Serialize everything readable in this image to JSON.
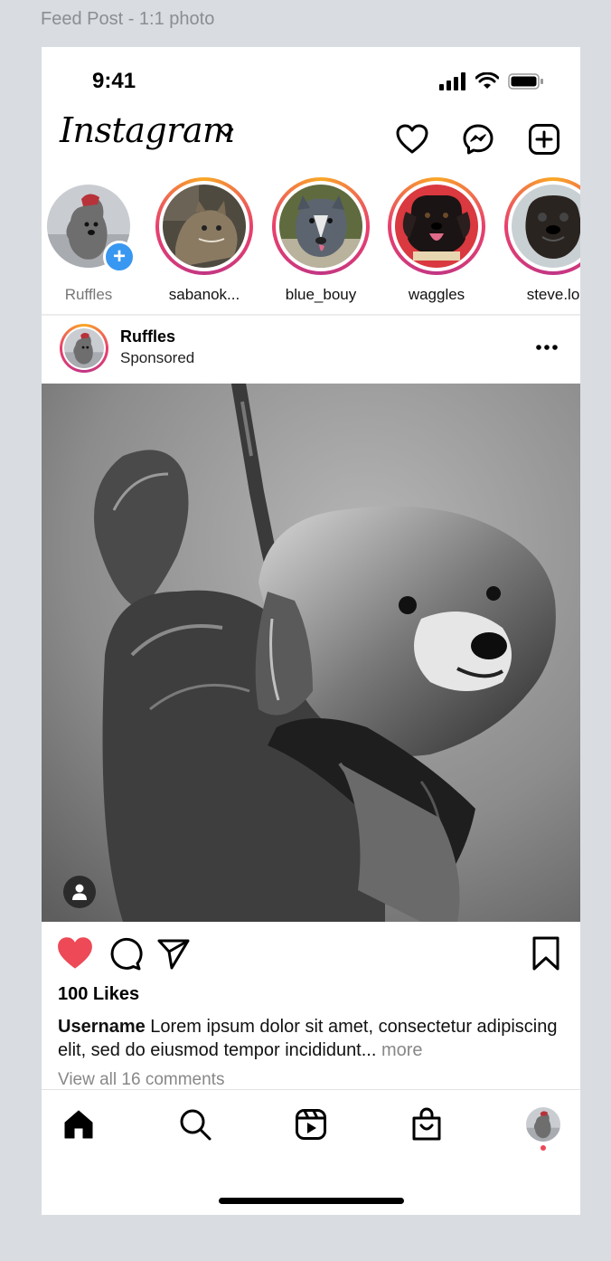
{
  "frame_label": "Feed Post - 1:1 photo",
  "status_bar": {
    "time": "9:41"
  },
  "header": {
    "logo_text": "Instagram"
  },
  "stories": [
    {
      "name": "Ruffles",
      "own": true
    },
    {
      "name": "sabanok..."
    },
    {
      "name": "blue_bouy"
    },
    {
      "name": "waggles"
    },
    {
      "name": "steve.lo"
    }
  ],
  "post": {
    "username": "Ruffles",
    "subtitle": "Sponsored",
    "likes": "100 Likes",
    "caption_user": "Username",
    "caption_text": " Lorem ipsum dolor sit amet, consectetur adipiscing elit, sed do eiusmod tempor incididunt...",
    "caption_more": " more",
    "comments_link": "View all 16 comments"
  },
  "colors": {
    "like_red": "#ed4956",
    "story_gradient": [
      "#f9a825",
      "#e8416d",
      "#c13584"
    ],
    "add_blue": "#3897f0",
    "canvas": "#d9dce0"
  },
  "icons": [
    "signal-icon",
    "wifi-icon",
    "battery-icon",
    "chevron-down-icon",
    "heart-outline-icon",
    "messenger-icon",
    "plus-square-icon",
    "more-dots-icon",
    "user-tag-icon",
    "heart-filled-icon",
    "comment-icon",
    "send-icon",
    "bookmark-icon",
    "home-icon",
    "search-icon",
    "reels-icon",
    "shop-icon",
    "profile-avatar"
  ]
}
